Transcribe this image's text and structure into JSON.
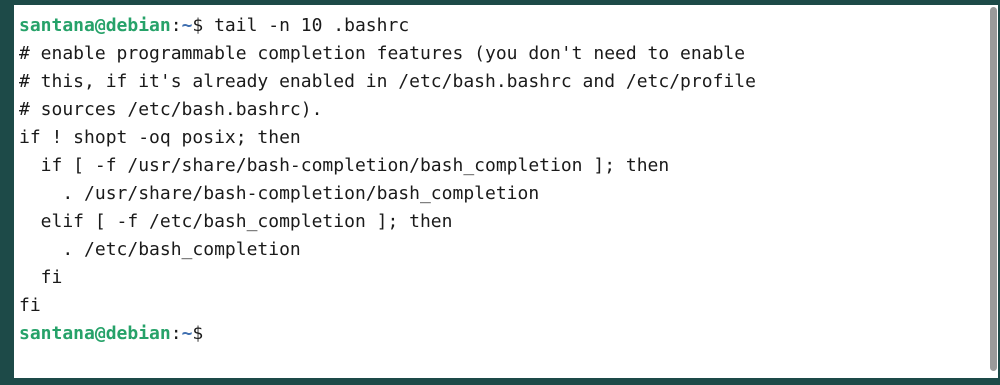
{
  "terminal": {
    "command_prompt": {
      "user_host": "santana@debian",
      "separator": ":",
      "path": "~",
      "symbol": "$",
      "command": " tail -n 10 .bashrc"
    },
    "output_lines": [
      "# enable programmable completion features (you don't need to enable",
      "# this, if it's already enabled in /etc/bash.bashrc and /etc/profile",
      "# sources /etc/bash.bashrc).",
      "if ! shopt -oq posix; then",
      "  if [ -f /usr/share/bash-completion/bash_completion ]; then",
      "    . /usr/share/bash-completion/bash_completion",
      "  elif [ -f /etc/bash_completion ]; then",
      "    . /etc/bash_completion",
      "  fi",
      "fi"
    ],
    "final_prompt": {
      "user_host": "santana@debian",
      "separator": ":",
      "path": "~",
      "symbol": "$"
    }
  },
  "colors": {
    "background": "#ffffff",
    "text": "#1a1a1a",
    "prompt_user": "#26a269",
    "prompt_path": "#3f6fb0",
    "window_frame": "#1d4a48",
    "scrollbar": "#9a9a9a"
  },
  "scrollbar": {
    "visible_fraction": 1.0
  }
}
